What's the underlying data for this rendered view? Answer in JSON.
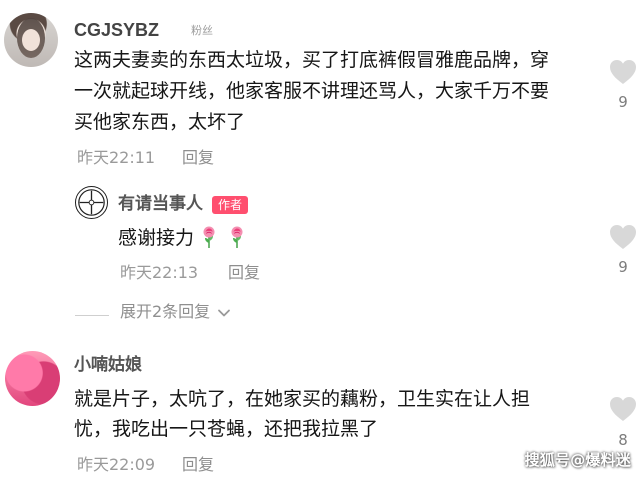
{
  "comments": [
    {
      "username": "CGJSYBZ",
      "badge": "粉丝",
      "lines": [
        "这两夫妻卖的东西太垃圾，买了打底裤假冒雅鹿品牌，穿",
        "一次就起球开线，他家客服不讲理还骂人，大家千万不要",
        "买他家东西，太坏了"
      ],
      "time": "昨天22:11",
      "reply": "回复",
      "likes": "9"
    },
    {
      "username": "有请当事人",
      "author_tag": "作者",
      "text": "感谢接力",
      "time": "昨天22:13",
      "reply": "回复",
      "likes": "9",
      "expand_text": "展开2条回复"
    },
    {
      "username": "小喃姑娘",
      "lines": [
        "就是片子，太吭了，在她家买的藕粉，卫生实在让人担",
        "忧，我吃出一只苍蝇，还把我拉黑了"
      ],
      "time": "昨天22:09",
      "reply": "回复",
      "likes": "8"
    }
  ],
  "watermark": "搜狐号@爆料迷",
  "icons": {
    "heart": "heart-icon",
    "chevron": "chevron-down-icon",
    "rose": "rose-icon"
  },
  "colors": {
    "author_tag": "#ff4f6f",
    "heart": "#d8d8d8",
    "meta": "#9a9a9a"
  }
}
